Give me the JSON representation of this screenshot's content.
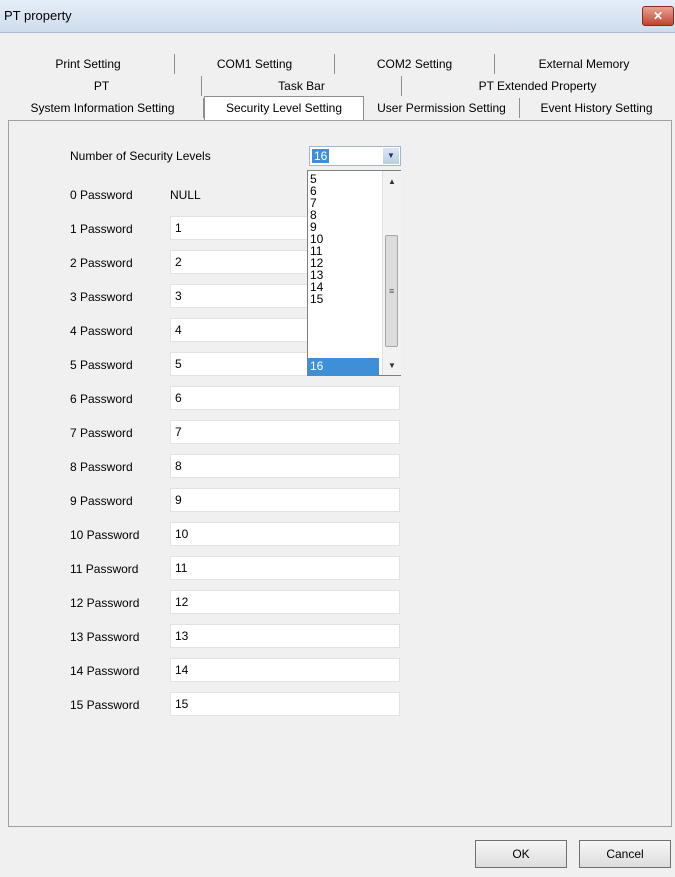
{
  "window": {
    "title": "PT property",
    "close_label": "✕"
  },
  "tabs": {
    "row1": [
      "Print Setting",
      "COM1 Setting",
      "COM2 Setting",
      "External Memory"
    ],
    "row2": [
      "PT",
      "Task Bar",
      "PT Extended Property"
    ],
    "row3": [
      "System Information Setting",
      "Security Level Setting",
      "User Permission Setting",
      "Event History Setting"
    ],
    "active": "Security Level Setting"
  },
  "security": {
    "levels_label": "Number of Security Levels",
    "levels_value": "16",
    "passwords": [
      {
        "label": "0 Password",
        "value": "NULL"
      },
      {
        "label": "1 Password",
        "value": "1"
      },
      {
        "label": "2 Password",
        "value": "2"
      },
      {
        "label": "3 Password",
        "value": "3"
      },
      {
        "label": "4 Password",
        "value": "4"
      },
      {
        "label": "5 Password",
        "value": "5"
      },
      {
        "label": "6 Password",
        "value": "6"
      },
      {
        "label": "7 Password",
        "value": "7"
      },
      {
        "label": "8 Password",
        "value": "8"
      },
      {
        "label": "9 Password",
        "value": "9"
      },
      {
        "label": "10 Password",
        "value": "10"
      },
      {
        "label": "11 Password",
        "value": "11"
      },
      {
        "label": "12 Password",
        "value": "12"
      },
      {
        "label": "13 Password",
        "value": "13"
      },
      {
        "label": "14 Password",
        "value": "14"
      },
      {
        "label": "15 Password",
        "value": "15"
      }
    ]
  },
  "dropdown": {
    "options": [
      "5",
      "6",
      "7",
      "8",
      "9",
      "10",
      "11",
      "12",
      "13",
      "14",
      "15",
      "16"
    ],
    "selected": "16"
  },
  "buttons": {
    "ok": "OK",
    "cancel": "Cancel"
  },
  "icons": {
    "close": "close-icon",
    "dropdown_arrow": "chevron-down-icon",
    "scroll_up": "scroll-up-arrow-icon",
    "scroll_down": "scroll-down-arrow-icon"
  },
  "colors": {
    "selection": "#3d8fd8",
    "titlebar": "#dbe6f3",
    "close": "#c0442f"
  }
}
